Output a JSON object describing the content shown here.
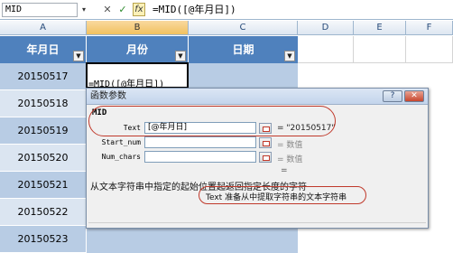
{
  "formula_bar": {
    "name_box": "MID",
    "name_box_arrow": "▾",
    "cancel_glyph": "✕",
    "confirm_glyph": "✓",
    "fx_label": "fx",
    "formula": "=MID([@年月日])"
  },
  "columns": [
    "A",
    "B",
    "C",
    "D",
    "E",
    "F"
  ],
  "table": {
    "headers": [
      "年月日",
      "月份",
      "日期"
    ],
    "dropdown_glyph": "▼",
    "rows": [
      "20150517",
      "20150518",
      "20150519",
      "20150520",
      "20150521",
      "20150522",
      "20150523"
    ],
    "active_cell_text": "=MID([@年月日])"
  },
  "dialog": {
    "title": "函数参数",
    "help_glyph": "?",
    "close_glyph": "✕",
    "function_name": "MID",
    "args": [
      {
        "label": "Text",
        "value": "[@年月日]",
        "result": "= \"20150517\""
      },
      {
        "label": "Start_num",
        "value": "",
        "result": "= 数值"
      },
      {
        "label": "Num_chars",
        "value": "",
        "result": "= 数值"
      }
    ],
    "total_result": "=",
    "description": "从文本字符串中指定的起始位置起返回指定长度的字符",
    "arg_description": "Text  准备从中提取字符串的文本字符串"
  },
  "colors": {
    "table_header": "#4f81bd",
    "band_dark": "#b8cce4",
    "band_light": "#dbe5f1",
    "highlight_ellipse": "#c0392b"
  }
}
